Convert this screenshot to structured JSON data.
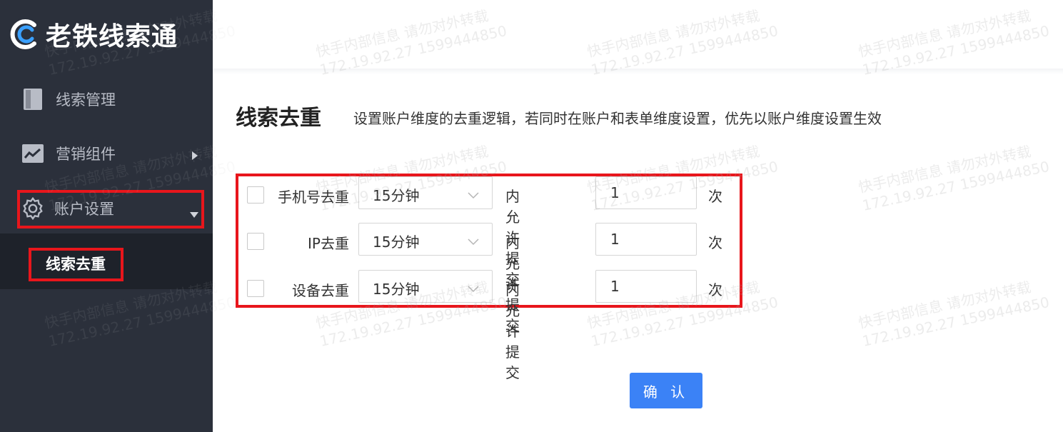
{
  "app": {
    "name": "老铁线索通"
  },
  "sidebar": {
    "items": [
      {
        "label": "线索管理",
        "icon": "book-icon"
      },
      {
        "label": "营销组件",
        "icon": "chart-icon"
      },
      {
        "label": "账户设置",
        "icon": "gear-icon"
      }
    ],
    "sub_item": {
      "label": "线索去重"
    }
  },
  "page": {
    "title": "线索去重",
    "subtitle": "设置账户维度的去重逻辑，若同时在账户和表单维度设置，优先以账户维度设置生效"
  },
  "rules": [
    {
      "label": "手机号去重",
      "interval": "15分钟",
      "middle": "内允许提交",
      "count": "1",
      "unit": "次",
      "checked": false
    },
    {
      "label": "IP去重",
      "interval": "15分钟",
      "middle": "内允许提交",
      "count": "1",
      "unit": "次",
      "checked": false
    },
    {
      "label": "设备去重",
      "interval": "15分钟",
      "middle": "内允许提交",
      "count": "1",
      "unit": "次",
      "checked": false
    }
  ],
  "confirm_label": "确 认",
  "watermark": {
    "line1": "快手内部信息 请勿对外转载",
    "line2": "172.19.92.27 1599444850"
  },
  "colors": {
    "sidebar_bg": "#2b303b",
    "highlight": "#e8161c",
    "primary": "#3b82f6"
  }
}
